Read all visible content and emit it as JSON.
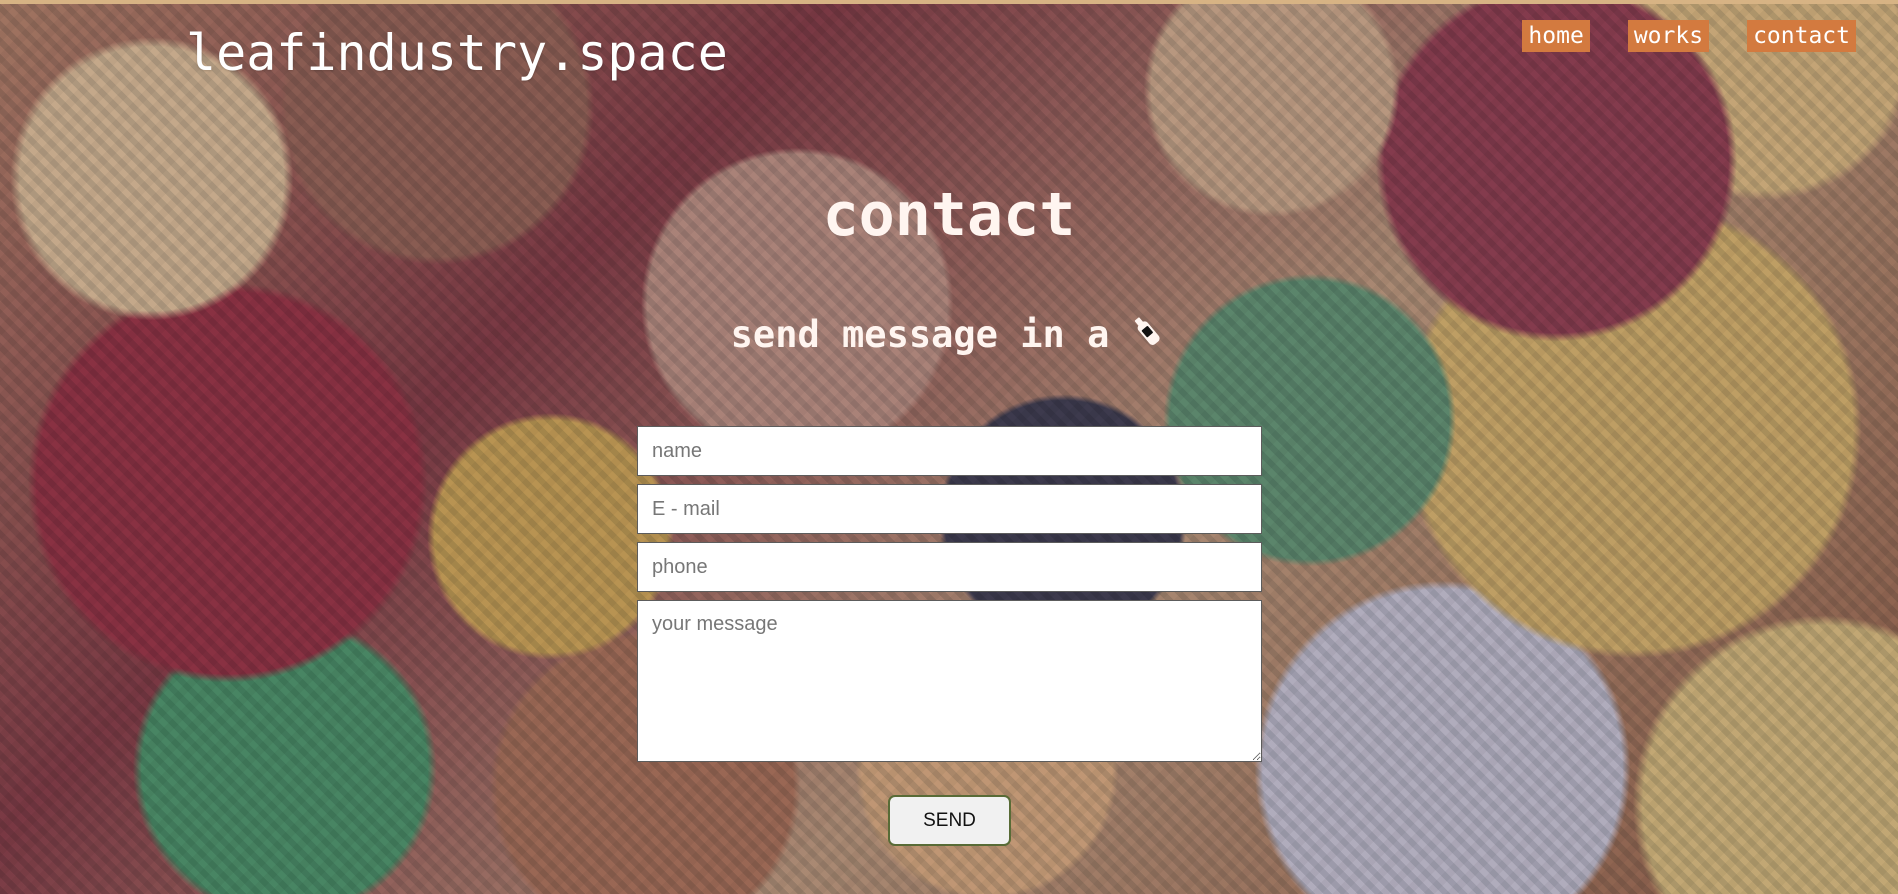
{
  "site": {
    "title": "leafindustry.space"
  },
  "nav": {
    "items": [
      {
        "label": "home"
      },
      {
        "label": "works"
      },
      {
        "label": "contact"
      }
    ]
  },
  "page": {
    "title": "contact",
    "subtitle": "send message in a",
    "subtitle_icon": "bottle-icon"
  },
  "form": {
    "name_placeholder": "name",
    "email_placeholder": "E - mail",
    "phone_placeholder": "phone",
    "message_placeholder": "your message",
    "send_label": "SEND"
  },
  "colors": {
    "nav_background": "#d37a3f",
    "title_text": "#fff5f0",
    "send_border": "#586b36"
  }
}
